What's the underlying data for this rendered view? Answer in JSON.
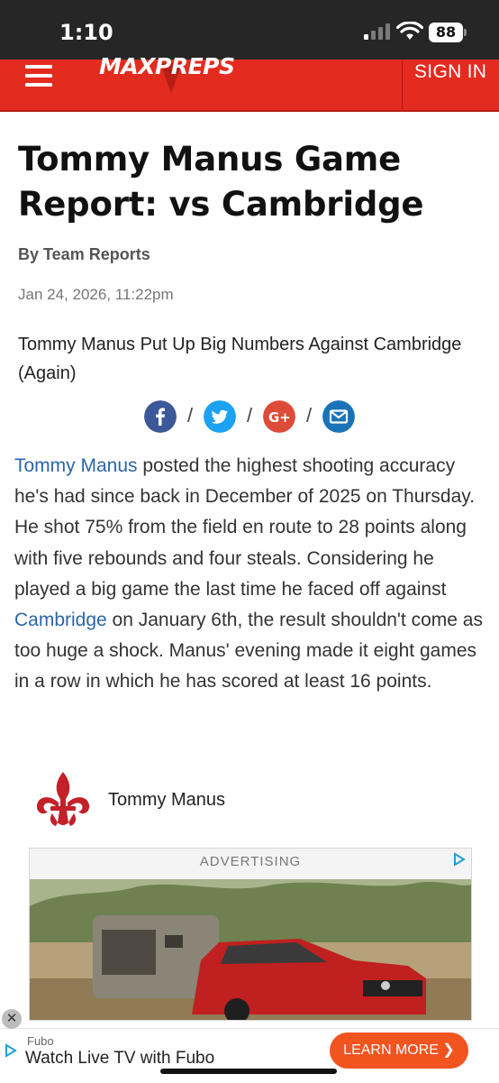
{
  "status_bar": {
    "time": "1:10",
    "battery": "88"
  },
  "header": {
    "logo_text": "MAXPREPS",
    "signin_label": "SIGN IN"
  },
  "article": {
    "title": "Tommy Manus Game Report: vs Cambridge",
    "byline": "By Team Reports",
    "date": "Jan 24, 2026, 11:22pm",
    "subtitle": "Tommy Manus Put Up Big Numbers Against Cambridge (Again)",
    "share_icons": [
      "facebook-icon",
      "twitter-icon",
      "google-plus-icon",
      "email-icon"
    ],
    "separator": "/",
    "body": {
      "player_link": "Tommy Manus",
      "part1": " posted the highest shooting accuracy he's had since back in December of 2025 on Thursday. He shot 75% from the field en route to 28 points along with five rebounds and four steals. Considering he played a big game the last time he faced off against ",
      "opponent_link": "Cambridge",
      "part2": " on January 6th, the result shouldn't come as too huge a shock. Manus' evening made it eight games in a row in which he has scored at least 16 points."
    },
    "player_card": {
      "name": "Tommy Manus",
      "icon": "fleur-de-lis-icon"
    }
  },
  "ad": {
    "label": "ADVERTISING"
  },
  "bottom_banner": {
    "brand": "Fubo",
    "text": "Watch Live TV with Fubo",
    "cta_label": "LEARN MORE ❯",
    "close_label": "✕"
  },
  "colors": {
    "header_red": "#e32b1f",
    "link_blue": "#2b66a8",
    "cta_orange": "#f25420"
  }
}
